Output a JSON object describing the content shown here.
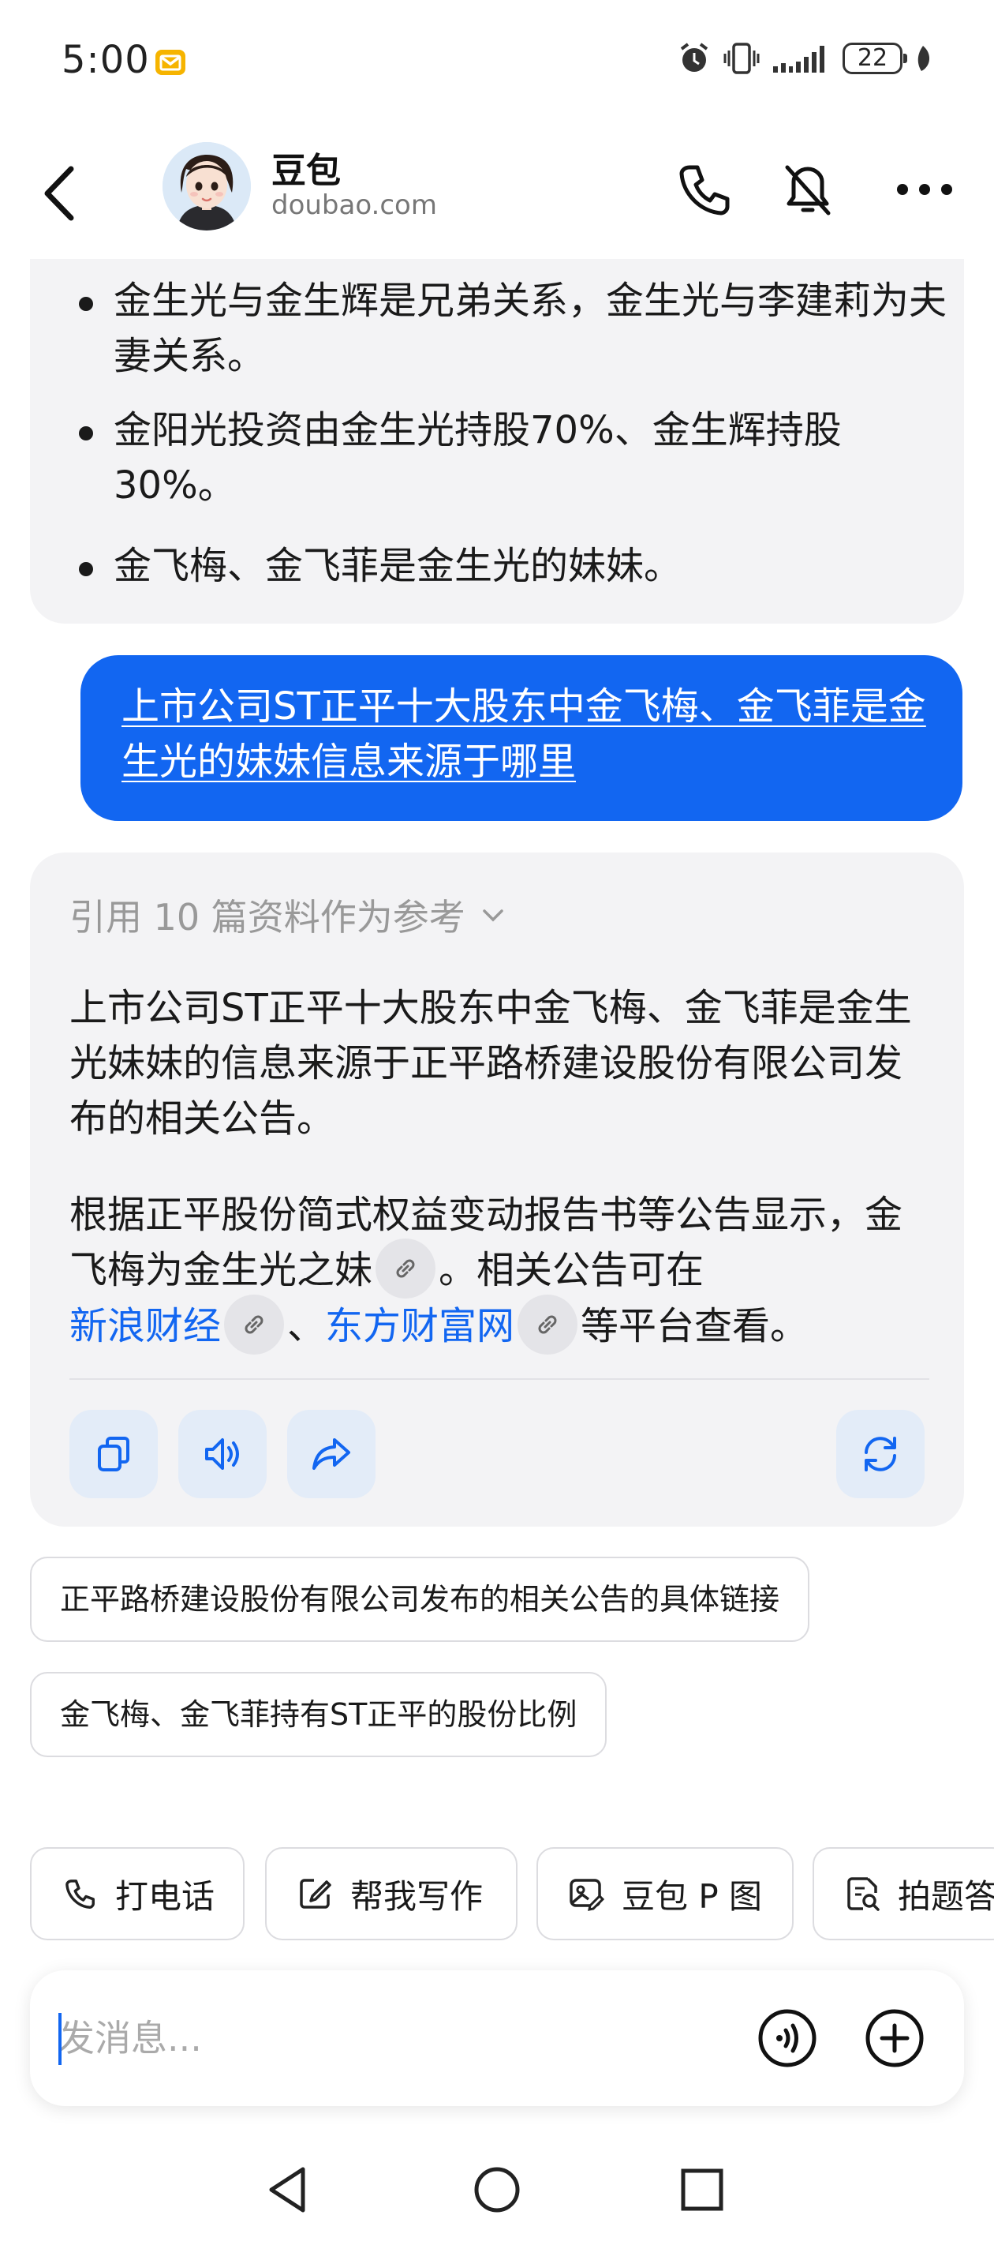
{
  "status_bar": {
    "time": "5:00",
    "battery": "22"
  },
  "header": {
    "title": "豆包",
    "subtitle": "doubao.com"
  },
  "previous_answer": {
    "bullets": [
      "金生光与金生辉是兄弟关系，金生光与李建莉为夫妻关系。",
      "金阳光投资由金生光持股70%、金生辉持股30%。",
      "金飞梅、金飞菲是金生光的妹妹。"
    ]
  },
  "user_message": "上市公司ST正平十大股东中金飞梅、金飞菲是金生光的妹妹信息来源于哪里",
  "answer": {
    "references_label": "引用 10 篇资料作为参考",
    "paragraph_1": "上市公司ST正平十大股东中金飞梅、金飞菲是金生光妹妹的信息来源于正平路桥建设股份有限公司发布的相关公告。",
    "paragraph_2_part_1": "根据正平股份简式权益变动报告书等公告显示，金飞梅为金生光之妹",
    "paragraph_2_part_2": "。相关公告可在",
    "link_1": "新浪财经",
    "separator": "、",
    "link_2": "东方财富网",
    "paragraph_2_part_3": "等平台查看。"
  },
  "suggestions": [
    "正平路桥建设股份有限公司发布的相关公告的具体链接",
    "金飞梅、金飞菲持有ST正平的股份比例"
  ],
  "tools": [
    {
      "label": "打电话",
      "icon": "phone-icon"
    },
    {
      "label": "帮我写作",
      "icon": "edit-icon"
    },
    {
      "label": "豆包 P 图",
      "icon": "image-edit-icon"
    },
    {
      "label": "拍题答",
      "icon": "photo-question-icon"
    }
  ],
  "input": {
    "placeholder": "发消息..."
  },
  "colors": {
    "accent": "#1266f1",
    "bubble_bg": "#f3f3f5",
    "action_bg": "#e3ecf8"
  }
}
